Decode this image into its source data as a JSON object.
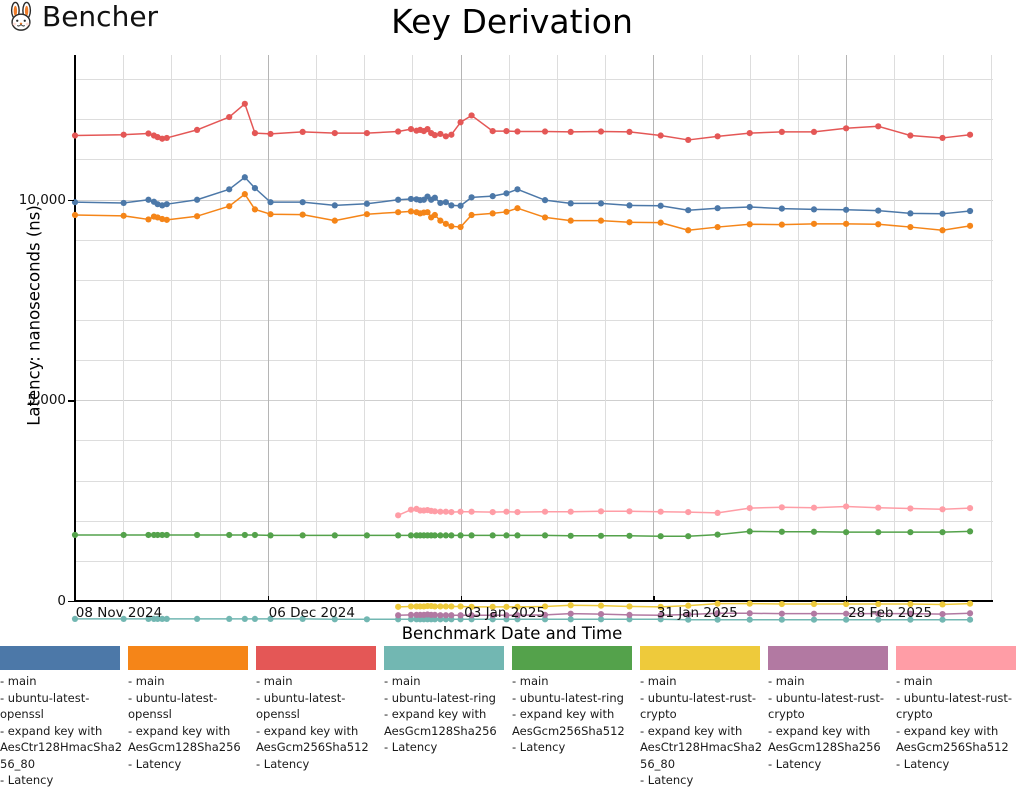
{
  "header": {
    "brand": "Bencher",
    "logo_icon": "rabbit-face-icon",
    "title": "Key Derivation"
  },
  "axes": {
    "ylabel": "Latency: nanoseconds (ns)",
    "xlabel": "Benchmark Date and Time",
    "yticks": [
      "0",
      "5,000",
      "10,000"
    ],
    "xticks": [
      "08 Nov 2024",
      "06 Dec 2024",
      "03 Jan 2025",
      "31 Jan 2025",
      "28 Feb 2025"
    ]
  },
  "legend": {
    "items": [
      {
        "color": "#4c78a8",
        "label": "- main\n- ubuntu-latest-openssl\n- expand key with AesCtr128HmacSha256_80\n- Latency"
      },
      {
        "color": "#f58518",
        "label": "- main\n- ubuntu-latest-openssl\n- expand key with AesGcm128Sha256\n- Latency"
      },
      {
        "color": "#e45756",
        "label": "- main\n- ubuntu-latest-openssl\n- expand key with AesGcm256Sha512\n- Latency"
      },
      {
        "color": "#72b7b2",
        "label": "- main\n- ubuntu-latest-ring\n- expand key with AesGcm128Sha256\n- Latency"
      },
      {
        "color": "#54a24b",
        "label": "- main\n- ubuntu-latest-ring\n- expand key with AesGcm256Sha512\n- Latency"
      },
      {
        "color": "#eeca3b",
        "label": "- main\n- ubuntu-latest-rust-crypto\n- expand key with AesCtr128HmacSha256_80\n- Latency"
      },
      {
        "color": "#b279a2",
        "label": "- main\n- ubuntu-latest-rust-crypto\n- expand key with AesGcm128Sha256\n- Latency"
      },
      {
        "color": "#ff9da6",
        "label": "- main\n- ubuntu-latest-rust-crypto\n- expand key with AesGcm256Sha512\n- Latency"
      }
    ]
  },
  "chart_data": {
    "type": "line",
    "title": "Key Derivation",
    "xlabel": "Benchmark Date and Time",
    "ylabel": "Latency: nanoseconds (ns)",
    "ylim": [
      0,
      13600
    ],
    "ytick_values": [
      0,
      5000,
      10000
    ],
    "ytick_labels": [
      "0",
      "5,000",
      "10,000"
    ],
    "xtick_labels": [
      "08 Nov 2024",
      "06 Dec 2024",
      "03 Jan 2025",
      "31 Jan 2025",
      "28 Feb 2025"
    ],
    "xtick_x": [
      0.0,
      0.21,
      0.42,
      0.63,
      0.84
    ],
    "grid": true,
    "legend_position": "bottom",
    "x_unit": "fraction of x-axis span (0 = 08 Nov 2024, 1 = right edge)",
    "series": [
      {
        "name": "main - ubuntu-latest-openssl - expand key with AesCtr128HmacSha256_80 - Latency",
        "color": "#4c78a8",
        "x": [
          0.0,
          0.053,
          0.08,
          0.086,
          0.09,
          0.095,
          0.1,
          0.133,
          0.168,
          0.185,
          0.196,
          0.213,
          0.248,
          0.283,
          0.318,
          0.352,
          0.366,
          0.372,
          0.376,
          0.38,
          0.384,
          0.388,
          0.392,
          0.398,
          0.404,
          0.41,
          0.42,
          0.432,
          0.455,
          0.47,
          0.482,
          0.512,
          0.54,
          0.573,
          0.604,
          0.638,
          0.668,
          0.7,
          0.735,
          0.77,
          0.805,
          0.84,
          0.875,
          0.91,
          0.945,
          0.975
        ],
        "y": [
          11080,
          11060,
          11140,
          11090,
          11030,
          11000,
          11030,
          11140,
          11400,
          11700,
          11430,
          11080,
          11080,
          11000,
          11040,
          11140,
          11160,
          11150,
          11130,
          11140,
          11220,
          11140,
          11190,
          11060,
          11080,
          11000,
          10990,
          11200,
          11230,
          11300,
          11400,
          11130,
          11050,
          11050,
          11000,
          10990,
          10880,
          10930,
          10960,
          10920,
          10900,
          10890,
          10870,
          10800,
          10790,
          10860
        ]
      },
      {
        "name": "main - ubuntu-latest-openssl - expand key with AesGcm128Sha256 - Latency",
        "color": "#f58518",
        "x": [
          0.0,
          0.053,
          0.08,
          0.086,
          0.09,
          0.095,
          0.1,
          0.133,
          0.168,
          0.185,
          0.196,
          0.213,
          0.248,
          0.283,
          0.318,
          0.352,
          0.366,
          0.372,
          0.376,
          0.38,
          0.384,
          0.388,
          0.392,
          0.398,
          0.404,
          0.41,
          0.42,
          0.432,
          0.455,
          0.47,
          0.482,
          0.512,
          0.54,
          0.573,
          0.604,
          0.638,
          0.668,
          0.7,
          0.735,
          0.77,
          0.805,
          0.84,
          0.875,
          0.91,
          0.945,
          0.975
        ],
        "y": [
          10760,
          10740,
          10650,
          10720,
          10700,
          10660,
          10640,
          10730,
          10980,
          11280,
          10900,
          10780,
          10770,
          10620,
          10780,
          10830,
          10850,
          10830,
          10800,
          10820,
          10830,
          10700,
          10760,
          10620,
          10540,
          10480,
          10460,
          10760,
          10800,
          10840,
          10930,
          10700,
          10620,
          10620,
          10580,
          10570,
          10380,
          10460,
          10530,
          10520,
          10540,
          10540,
          10530,
          10460,
          10380,
          10490
        ]
      },
      {
        "name": "main - ubuntu-latest-openssl - expand key with AesGcm256Sha512 - Latency",
        "color": "#e45756",
        "x": [
          0.0,
          0.053,
          0.08,
          0.086,
          0.09,
          0.095,
          0.1,
          0.133,
          0.168,
          0.185,
          0.196,
          0.213,
          0.248,
          0.283,
          0.318,
          0.352,
          0.366,
          0.372,
          0.376,
          0.38,
          0.384,
          0.388,
          0.392,
          0.398,
          0.404,
          0.41,
          0.42,
          0.432,
          0.455,
          0.47,
          0.482,
          0.512,
          0.54,
          0.573,
          0.604,
          0.638,
          0.668,
          0.7,
          0.735,
          0.77,
          0.805,
          0.84,
          0.875,
          0.91,
          0.945,
          0.975
        ],
        "y": [
          12740,
          12760,
          12790,
          12740,
          12700,
          12660,
          12680,
          12880,
          13200,
          13530,
          12800,
          12780,
          12830,
          12800,
          12800,
          12840,
          12900,
          12860,
          12880,
          12850,
          12900,
          12800,
          12750,
          12780,
          12720,
          12760,
          13070,
          13240,
          12850,
          12850,
          12840,
          12840,
          12830,
          12840,
          12830,
          12740,
          12630,
          12720,
          12800,
          12830,
          12830,
          12920,
          12970,
          12740,
          12680,
          12760
        ]
      },
      {
        "name": "main - ubuntu-latest-ring - expand key with AesGcm128Sha256 - Latency",
        "color": "#72b7b2",
        "x": [
          0.0,
          0.053,
          0.08,
          0.086,
          0.09,
          0.095,
          0.1,
          0.133,
          0.168,
          0.185,
          0.196,
          0.213,
          0.248,
          0.283,
          0.318,
          0.352,
          0.366,
          0.372,
          0.376,
          0.38,
          0.384,
          0.388,
          0.392,
          0.398,
          0.404,
          0.41,
          0.42,
          0.432,
          0.455,
          0.47,
          0.482,
          0.512,
          0.54,
          0.573,
          0.604,
          0.638,
          0.668,
          0.7,
          0.735,
          0.77,
          0.805,
          0.84,
          0.875,
          0.91,
          0.945,
          0.975
        ],
        "y": [
          700,
          700,
          700,
          700,
          700,
          700,
          700,
          700,
          700,
          700,
          700,
          700,
          700,
          690,
          690,
          690,
          690,
          690,
          690,
          690,
          690,
          690,
          690,
          690,
          690,
          690,
          690,
          690,
          690,
          690,
          690,
          690,
          690,
          690,
          690,
          690,
          680,
          680,
          680,
          680,
          680,
          680,
          680,
          680,
          680,
          680
        ]
      },
      {
        "name": "main - ubuntu-latest-ring - expand key with AesGcm256Sha512 - Latency",
        "color": "#54a24b",
        "x": [
          0.0,
          0.053,
          0.08,
          0.086,
          0.09,
          0.095,
          0.1,
          0.133,
          0.168,
          0.185,
          0.196,
          0.213,
          0.248,
          0.283,
          0.318,
          0.352,
          0.366,
          0.372,
          0.376,
          0.38,
          0.384,
          0.388,
          0.392,
          0.398,
          0.404,
          0.41,
          0.42,
          0.432,
          0.455,
          0.47,
          0.482,
          0.512,
          0.54,
          0.573,
          0.604,
          0.638,
          0.668,
          0.7,
          0.735,
          0.77,
          0.805,
          0.84,
          0.875,
          0.91,
          0.945,
          0.975
        ],
        "y": [
          2790,
          2790,
          2790,
          2790,
          2790,
          2790,
          2790,
          2790,
          2790,
          2790,
          2790,
          2780,
          2780,
          2780,
          2780,
          2780,
          2780,
          2780,
          2780,
          2780,
          2780,
          2780,
          2780,
          2780,
          2780,
          2780,
          2780,
          2780,
          2780,
          2780,
          2780,
          2780,
          2770,
          2770,
          2770,
          2760,
          2760,
          2800,
          2880,
          2870,
          2870,
          2860,
          2860,
          2860,
          2860,
          2880
        ]
      },
      {
        "name": "main - ubuntu-latest-rust-crypto - expand key with AesCtr128HmacSha256_80 - Latency",
        "color": "#eeca3b",
        "x": [
          0.352,
          0.366,
          0.372,
          0.376,
          0.38,
          0.384,
          0.388,
          0.392,
          0.398,
          0.404,
          0.41,
          0.42,
          0.432,
          0.455,
          0.47,
          0.482,
          0.512,
          0.54,
          0.573,
          0.604,
          0.638,
          0.668,
          0.7,
          0.735,
          0.77,
          0.805,
          0.84,
          0.875,
          0.91,
          0.945,
          0.975
        ],
        "y": [
          1000,
          1010,
          1010,
          1010,
          1010,
          1020,
          1020,
          1010,
          1010,
          1010,
          1010,
          1010,
          1000,
          1000,
          1000,
          1000,
          1010,
          1040,
          1030,
          1010,
          1000,
          1030,
          1080,
          1080,
          1070,
          1070,
          1070,
          1070,
          1070,
          1060,
          1080
        ]
      },
      {
        "name": "main - ubuntu-latest-rust-crypto - expand key with AesGcm128Sha256 - Latency",
        "color": "#b279a2",
        "x": [
          0.352,
          0.366,
          0.372,
          0.376,
          0.38,
          0.384,
          0.388,
          0.392,
          0.398,
          0.404,
          0.41,
          0.42,
          0.432,
          0.455,
          0.47,
          0.482,
          0.512,
          0.54,
          0.573,
          0.604,
          0.638,
          0.668,
          0.7,
          0.735,
          0.77,
          0.805,
          0.84,
          0.875,
          0.91,
          0.945,
          0.975
        ],
        "y": [
          790,
          800,
          800,
          800,
          800,
          810,
          800,
          800,
          790,
          790,
          790,
          790,
          790,
          790,
          790,
          790,
          800,
          830,
          820,
          800,
          790,
          810,
          840,
          840,
          830,
          830,
          830,
          830,
          830,
          820,
          840
        ]
      },
      {
        "name": "main - ubuntu-latest-rust-crypto - expand key with AesGcm256Sha512 - Latency",
        "color": "#ff9da6",
        "x": [
          0.352,
          0.366,
          0.372,
          0.376,
          0.38,
          0.384,
          0.388,
          0.392,
          0.398,
          0.404,
          0.41,
          0.42,
          0.432,
          0.455,
          0.47,
          0.482,
          0.512,
          0.54,
          0.573,
          0.604,
          0.638,
          0.668,
          0.7,
          0.735,
          0.77,
          0.805,
          0.84,
          0.875,
          0.91,
          0.945,
          0.975
        ],
        "y": [
          3280,
          3420,
          3440,
          3400,
          3400,
          3410,
          3390,
          3380,
          3370,
          3370,
          3360,
          3370,
          3370,
          3360,
          3370,
          3360,
          3370,
          3370,
          3380,
          3380,
          3370,
          3360,
          3340,
          3460,
          3480,
          3470,
          3500,
          3470,
          3450,
          3430,
          3460
        ]
      }
    ]
  }
}
